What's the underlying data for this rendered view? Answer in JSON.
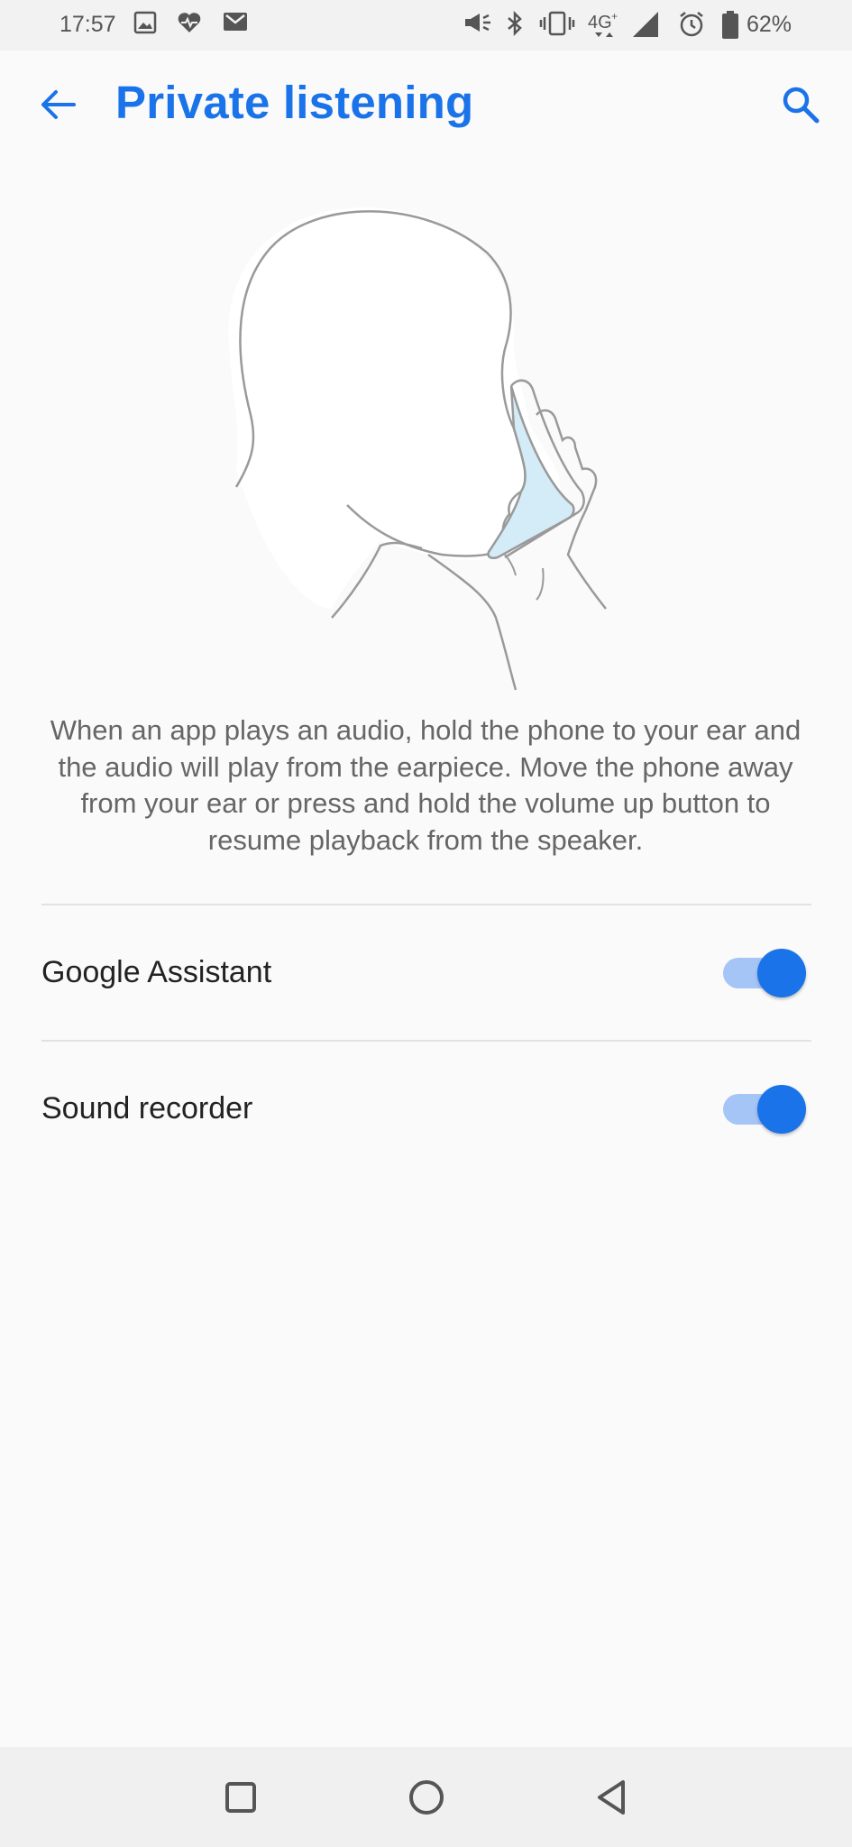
{
  "status_bar": {
    "time": "17:57",
    "battery_percent": "62%",
    "network": "4G",
    "icons": [
      "image-icon",
      "heart-icon",
      "gmail-icon",
      "megaphone-icon",
      "bluetooth-icon",
      "vibrate-icon",
      "4g-icon",
      "signal-icon",
      "alarm-icon",
      "battery-icon"
    ]
  },
  "app_bar": {
    "title": "Private listening",
    "back_icon": "arrow-back-icon",
    "search_icon": "search-icon"
  },
  "description": "When an app plays an audio, hold the phone to your ear and the audio will play from the earpiece. Move the phone away from your ear or press and hold the volume up button to resume playback from the speaker.",
  "settings": [
    {
      "label": "Google Assistant",
      "enabled": true
    },
    {
      "label": "Sound recorder",
      "enabled": true
    }
  ],
  "colors": {
    "accent": "#1a73e8",
    "toggle_track": "#a5c5f7",
    "phone_screen": "#d4ecf8"
  },
  "nav_bar": {
    "icons": [
      "recent-apps-icon",
      "home-icon",
      "back-triangle-icon"
    ]
  }
}
